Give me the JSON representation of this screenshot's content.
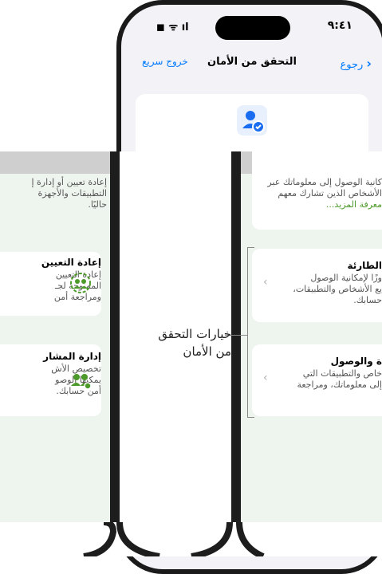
{
  "status": {
    "time": "٩:٤١",
    "icons": "◼︎ ᯤ ıl"
  },
  "nav": {
    "back": "رجوع",
    "title": "التحقق من الأمان",
    "quick_exit": "خروج سريع"
  },
  "left_panel": {
    "top_text": [
      "إعادة تعيين أو إدارة إ",
      "التطبيقات والأجهزة",
      "حاليًا."
    ],
    "reset_card": {
      "title": "إعادة التعيين",
      "lines": [
        "إعادة التعيين",
        "الممنوحة لجـ",
        "ومراجعة أمن"
      ]
    },
    "manage_card": {
      "title": "إدارة المشار",
      "lines": [
        "تخصيص الأش",
        "يمكنها الوصو",
        "أمن حسابك."
      ]
    }
  },
  "right_panel": {
    "top_lines": [
      "كانية الوصول إلى معلوماتك عبر",
      "الأشخاص الذين تشارك معهم",
      "معرفة المزيد..."
    ],
    "emergency_card": {
      "title": "الطارئة",
      "lines": [
        "وزًا لإمكانية الوصول",
        "يع الأشخاص والتطبيقات،",
        "حسابك."
      ]
    },
    "access_card": {
      "title": "ة والوصول",
      "lines": [
        "خاص والتطبيقات التي",
        "إلى معلوماتك، ومراجعة"
      ]
    }
  },
  "callout": {
    "line1": "خيارات التحقق",
    "line2": "من الأمان"
  },
  "colors": {
    "accent": "#007aff",
    "green": "#4c9a2a",
    "panel_bg": "#eef4ee"
  }
}
